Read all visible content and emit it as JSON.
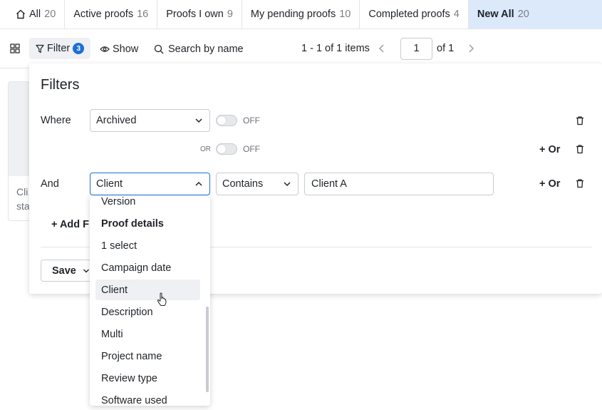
{
  "tabs": [
    {
      "label": "All",
      "count": "20",
      "icon": "home-icon"
    },
    {
      "label": "Active proofs",
      "count": "16"
    },
    {
      "label": "Proofs I own",
      "count": "9"
    },
    {
      "label": "My pending proofs",
      "count": "10"
    },
    {
      "label": "Completed proofs",
      "count": "4"
    },
    {
      "label": "New All",
      "count": "20",
      "active": true
    }
  ],
  "toolbar": {
    "filter_label": "Filter",
    "filter_count": "3",
    "show_label": "Show",
    "search_label": "Search by name",
    "pager_text": "1 - 1 of 1 items",
    "page_value": "1",
    "of_text": "of 1"
  },
  "background_card": {
    "line1": "Cli",
    "line2": "sta"
  },
  "filters": {
    "title": "Filters",
    "rows": [
      {
        "prefix": "Where",
        "field": "Archived",
        "toggle_label": "OFF",
        "toggle_on": false
      },
      {
        "or_label": "OR",
        "toggle_label": "OFF",
        "toggle_on": false,
        "or_button": "+ Or"
      },
      {
        "prefix": "And",
        "field": "Client",
        "operator": "Contains",
        "value": "Client A",
        "or_button": "+ Or"
      }
    ],
    "add_filter_label": "+ Add Fi",
    "save_label": "Save"
  },
  "dropdown": {
    "items": [
      {
        "label": "Version",
        "type": "option"
      },
      {
        "label": "Proof details",
        "type": "header"
      },
      {
        "label": "1 select",
        "type": "option"
      },
      {
        "label": "Campaign date",
        "type": "option"
      },
      {
        "label": "Client",
        "type": "option",
        "hovered": true
      },
      {
        "label": "Description",
        "type": "option"
      },
      {
        "label": "Multi",
        "type": "option"
      },
      {
        "label": "Project name",
        "type": "option"
      },
      {
        "label": "Review type",
        "type": "option"
      },
      {
        "label": "Software used",
        "type": "option"
      }
    ]
  },
  "colors": {
    "accent": "#1f6fd6",
    "active_tab_bg": "#dbe9fb",
    "border": "#c8ccd2"
  }
}
